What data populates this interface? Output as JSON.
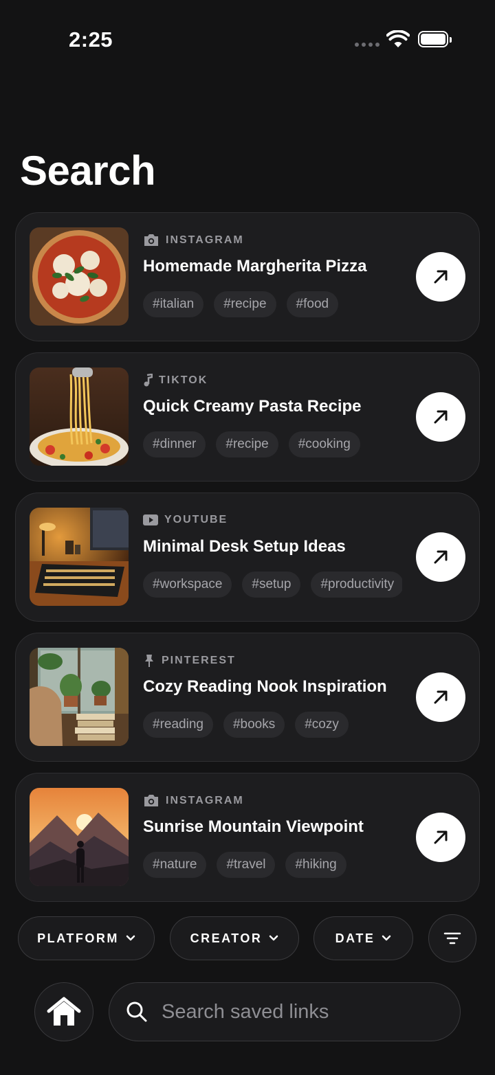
{
  "status_bar": {
    "time": "2:25"
  },
  "page": {
    "title": "Search"
  },
  "results": [
    {
      "platform": "INSTAGRAM",
      "platform_icon": "camera-icon",
      "title": "Homemade Margherita Pizza",
      "tags": [
        "#italian",
        "#recipe",
        "#food"
      ],
      "thumbnail": "pizza"
    },
    {
      "platform": "TIKTOK",
      "platform_icon": "music-note-icon",
      "title": "Quick Creamy Pasta Recipe",
      "tags": [
        "#dinner",
        "#recipe",
        "#cooking"
      ],
      "thumbnail": "pasta"
    },
    {
      "platform": "YOUTUBE",
      "platform_icon": "play-icon",
      "title": "Minimal Desk Setup Ideas",
      "tags": [
        "#workspace",
        "#setup",
        "#productivity"
      ],
      "thumbnail": "desk"
    },
    {
      "platform": "PINTEREST",
      "platform_icon": "pin-icon",
      "title": "Cozy Reading Nook Inspiration",
      "tags": [
        "#reading",
        "#books",
        "#cozy"
      ],
      "thumbnail": "reading-nook"
    },
    {
      "platform": "INSTAGRAM",
      "platform_icon": "camera-icon",
      "title": "Sunrise Mountain Viewpoint",
      "tags": [
        "#nature",
        "#travel",
        "#hiking"
      ],
      "thumbnail": "mountain"
    }
  ],
  "filters": [
    {
      "label": "PLATFORM"
    },
    {
      "label": "CREATOR"
    },
    {
      "label": "DATE"
    }
  ],
  "search": {
    "placeholder": "Search saved links"
  },
  "colors": {
    "background": "#131314",
    "card": "#1d1d1f",
    "tag": "#2a2a2d",
    "muted_text": "#9a9a9f",
    "accent": "#ffffff"
  }
}
